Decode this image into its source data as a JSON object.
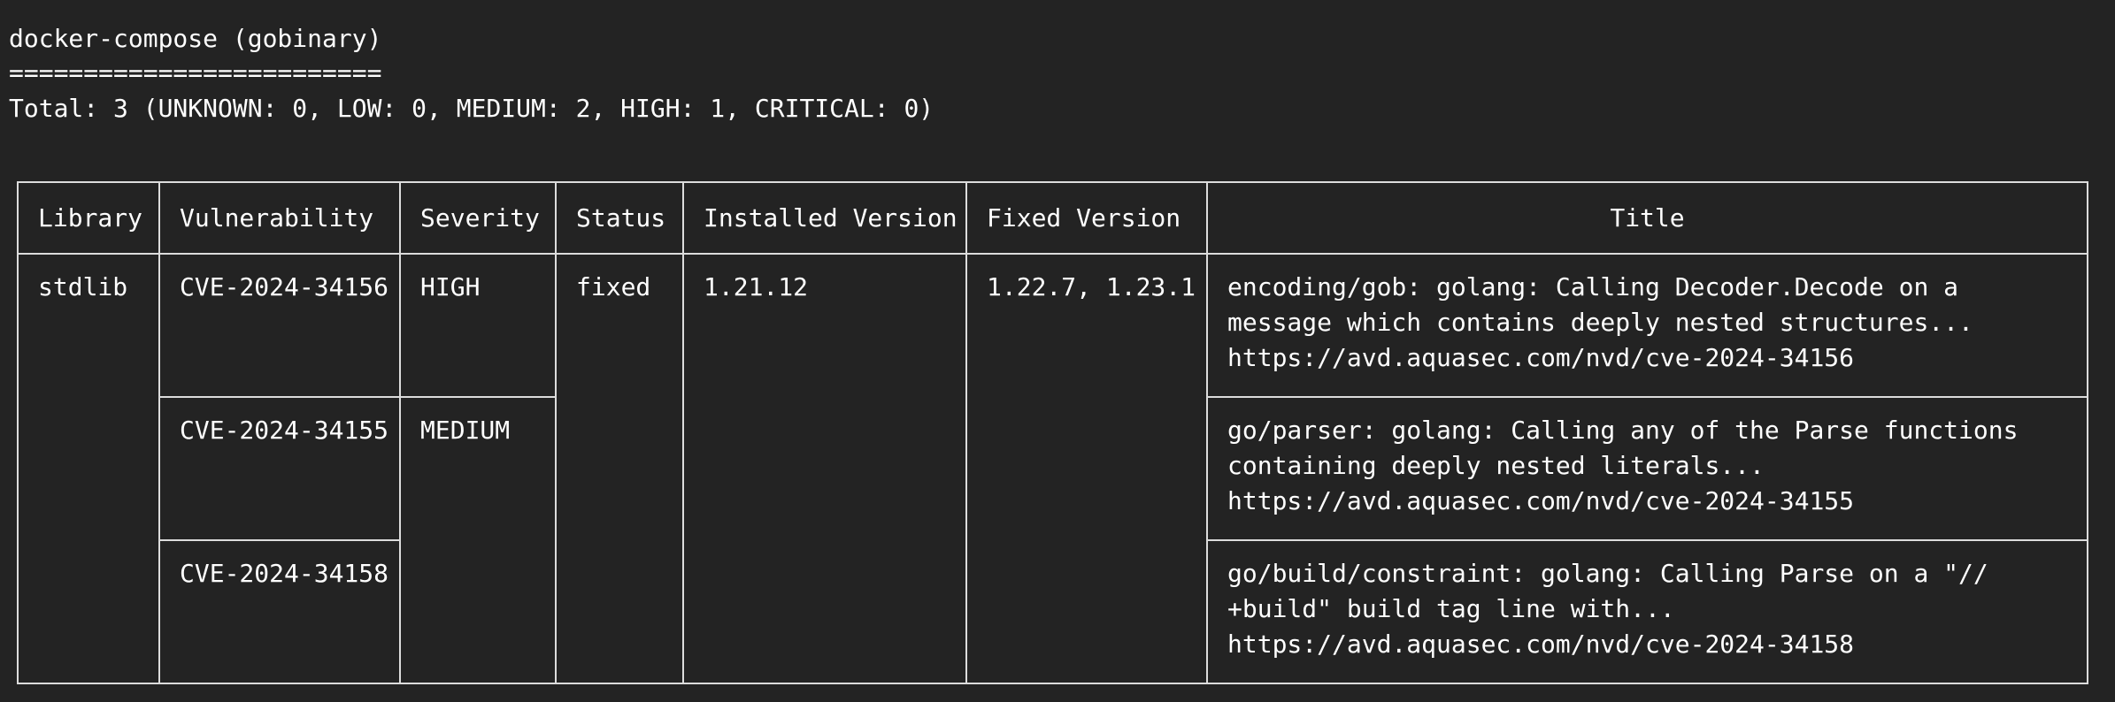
{
  "report": {
    "heading": "docker-compose (gobinary)",
    "underline": "=========================",
    "total": "Total: 3 (UNKNOWN: 0, LOW: 0, MEDIUM: 2, HIGH: 1, CRITICAL: 0)"
  },
  "table": {
    "columns": {
      "library": "Library",
      "vulnerability": "Vulnerability",
      "severity": "Severity",
      "status": "Status",
      "installed": "Installed Version",
      "fixed": "Fixed Version",
      "title": "Title"
    },
    "library": "stdlib",
    "status": "fixed",
    "installed": "1.21.12",
    "fixed": "1.22.7, 1.23.1",
    "severity_high": "HIGH",
    "severity_medium": "MEDIUM",
    "rows": [
      {
        "vulnerability": "CVE-2024-34156",
        "title": "encoding/gob: golang: Calling Decoder.Decode on a message which contains deeply nested structures...",
        "url": "https://avd.aquasec.com/nvd/cve-2024-34156"
      },
      {
        "vulnerability": "CVE-2024-34155",
        "title": "go/parser: golang: Calling any of the Parse functions containing deeply nested literals...",
        "url": "https://avd.aquasec.com/nvd/cve-2024-34155"
      },
      {
        "vulnerability": "CVE-2024-34158",
        "title": "go/build/constraint: golang: Calling Parse on a \"// +build\" build tag line with...",
        "url": "https://avd.aquasec.com/nvd/cve-2024-34158"
      }
    ]
  }
}
